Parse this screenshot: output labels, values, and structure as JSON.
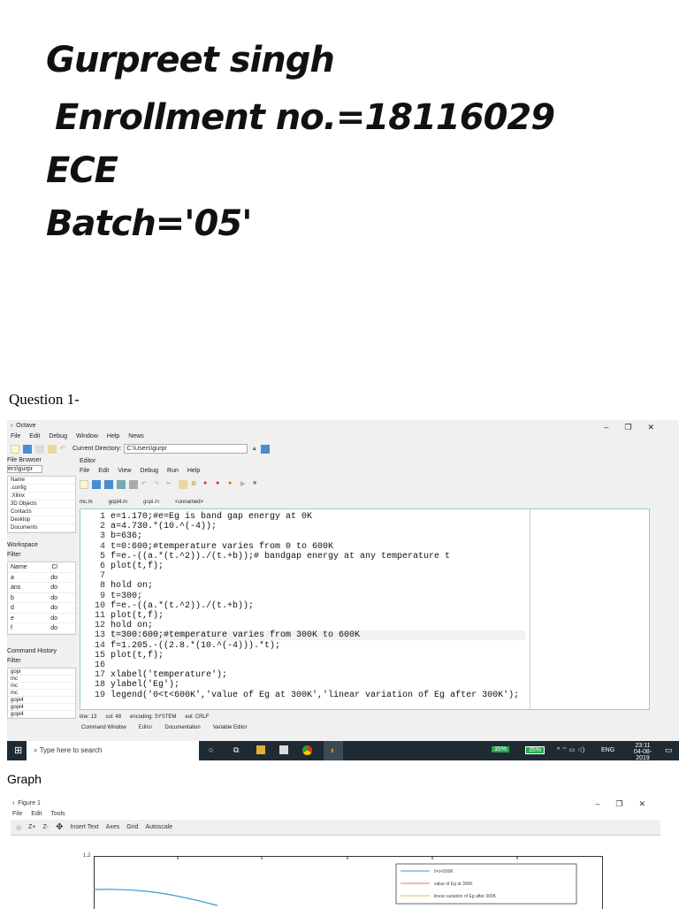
{
  "header": {
    "name": "Gurpreet singh",
    "enrollment": "Enrollment no.=18116029",
    "branch": "ECE",
    "batch": "Batch='05'"
  },
  "question_label": "Question 1-",
  "graph_label": "Graph",
  "octave": {
    "title": "Octave",
    "menu": [
      "File",
      "Edit",
      "Debug",
      "Window",
      "Help",
      "News"
    ],
    "current_dir_label": "Current Directory:",
    "current_dir": "C:\\Users\\gurpr",
    "file_browser": {
      "title": "File Browser",
      "path": "ers\\gurpr",
      "col": "Name",
      "items": [
        ".config",
        ".Xilinx",
        "3D Objects",
        "Contacts",
        "Desktop",
        "Documents"
      ]
    },
    "workspace": {
      "title": "Workspace",
      "filter": "Filter",
      "cols": [
        "Name",
        "Cl"
      ],
      "rows": [
        [
          "a",
          "do"
        ],
        [
          "ans",
          "do"
        ],
        [
          "b",
          "do"
        ],
        [
          "d",
          "do"
        ],
        [
          "e",
          "do"
        ],
        [
          "f",
          "do"
        ]
      ]
    },
    "history": {
      "title": "Command History",
      "filter": "Filter",
      "items": [
        "gopi",
        "mc",
        "mc",
        "mc",
        "gopi4",
        "gopi4",
        "gopi4"
      ]
    },
    "editor": {
      "title": "Editor",
      "menu": [
        "File",
        "Edit",
        "View",
        "Debug",
        "Run",
        "Help"
      ],
      "tabs": [
        "mc.m",
        "gopi4.m",
        "gopi.m",
        "<unnamed>"
      ],
      "lines": [
        "e=1.170;#e=Eg is band gap energy at 0K",
        "a=4.730.*(10.^(-4));",
        "b=636;",
        "t=0:600;#temperature varies from 0 to 600K",
        "f=e.-((a.*(t.^2))./(t.+b));# bandgap energy at any temperature t",
        "plot(t,f);",
        "",
        "hold on;",
        "t=300;",
        "f=e.-((a.*(t.^2))./(t.+b));",
        "plot(t,f);",
        "hold on;",
        "t=300:600;#temperature varies from 300K to 600K",
        "f=1.205.-((2.8.*(10.^(-4))).*t);",
        "plot(t,f);",
        "",
        "xlabel('temperature');",
        "ylabel('Eg');",
        "legend('0<t<600K','value of Eg at 300K','linear variation of Eg after 300K');"
      ],
      "status": [
        "line: 13",
        "col: 48",
        "encoding: SYSTEM",
        "eol: CRLF"
      ],
      "bottom_tabs": [
        "Command Window",
        "Editor",
        "Documentation",
        "Variable Editor"
      ]
    }
  },
  "taskbar": {
    "search": "Type here to search",
    "battery1": "35%",
    "battery2": "35%",
    "lang": "ENG",
    "time": "23:11",
    "date": "04-08-2019"
  },
  "figure": {
    "title": "Figure 1",
    "menu": [
      "File",
      "Edit",
      "Tools"
    ],
    "toolbar": [
      "Z+",
      "Z-",
      "Insert Text",
      "Axes",
      "Grid",
      "Autoscale"
    ],
    "ytick": "1.2",
    "legend": [
      "0<t<600K",
      "value of Eg at 300K",
      "linear variation of Eg after 300K"
    ],
    "colors": [
      "#3a9ad0",
      "#e0804a",
      "#e8c040"
    ]
  }
}
